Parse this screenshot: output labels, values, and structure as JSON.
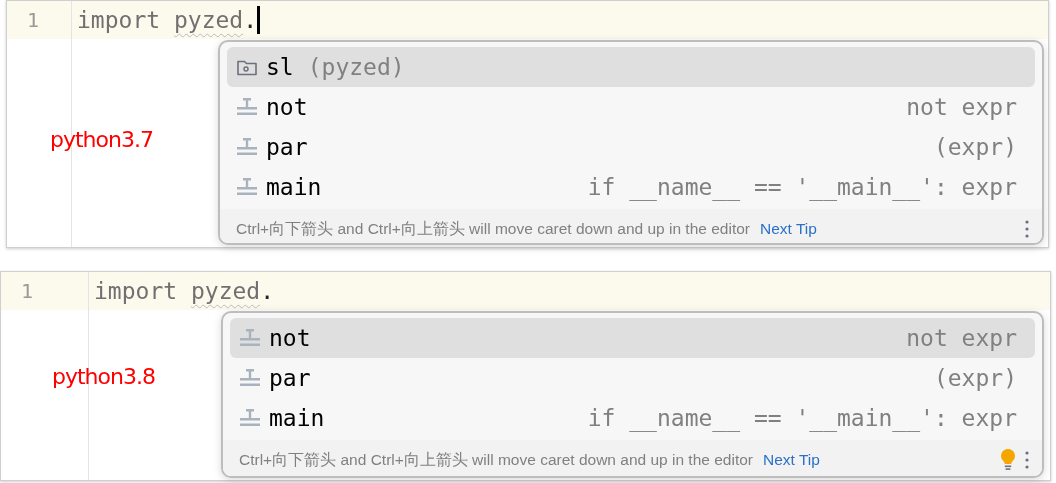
{
  "panels": [
    {
      "line_number": "1",
      "code": [
        {
          "text": "import ",
          "warning": false
        },
        {
          "text": "pyzed",
          "warning": true
        },
        {
          "text": ".",
          "warning": false
        }
      ],
      "caret": true,
      "annotation": "python3.7",
      "completion": {
        "items": [
          {
            "kind": "package",
            "name": "sl",
            "hint": "(pyzed)",
            "selected": true
          },
          {
            "kind": "template",
            "name": "not",
            "tail": "not expr",
            "selected": false
          },
          {
            "kind": "template",
            "name": "par",
            "tail": "(expr)",
            "selected": false
          },
          {
            "kind": "template",
            "name": "main",
            "tail": "if __name__ == '__main__': expr",
            "selected": false
          }
        ],
        "tip": "Ctrl+向下箭头 and Ctrl+向上箭头 will move caret down and up in the editor",
        "tip_link": "Next Tip",
        "bulb": false
      }
    },
    {
      "line_number": "1",
      "code": [
        {
          "text": "import ",
          "warning": false
        },
        {
          "text": "pyzed",
          "warning": true
        },
        {
          "text": ".",
          "warning": false
        }
      ],
      "caret": false,
      "annotation": "python3.8",
      "completion": {
        "items": [
          {
            "kind": "template",
            "name": "not",
            "tail": "not expr",
            "selected": true
          },
          {
            "kind": "template",
            "name": "par",
            "tail": "(expr)",
            "selected": false
          },
          {
            "kind": "template",
            "name": "main",
            "tail": "if __name__ == '__main__': expr",
            "selected": false
          }
        ],
        "tip": "Ctrl+向下箭头 and Ctrl+向上箭头 will move caret down and up in the editor",
        "tip_link": "Next Tip",
        "bulb": true
      }
    }
  ]
}
